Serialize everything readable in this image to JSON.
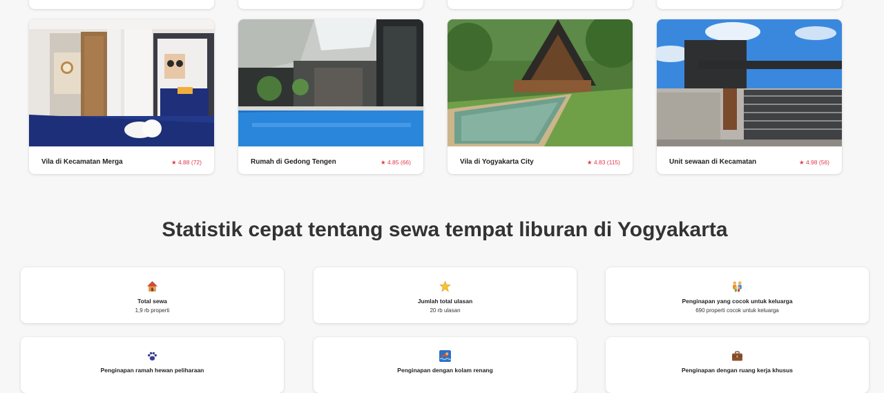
{
  "listings": [
    {
      "title": "Vila di Kecamatan Merga",
      "rating": "★ 4.88 (72)",
      "photo_icon": "bedroom-photo"
    },
    {
      "title": "Rumah di Gedong Tengen",
      "rating": "★ 4.85 (66)",
      "photo_icon": "indoor-pool-photo"
    },
    {
      "title": "Vila di Yogyakarta City",
      "rating": "★ 4.83 (115)",
      "photo_icon": "a-frame-villa-photo"
    },
    {
      "title": "Unit sewaan di Kecamatan",
      "rating": "★ 4.98 (56)",
      "photo_icon": "modern-house-photo"
    }
  ],
  "stats_section": {
    "title": "Statistik cepat tentang sewa tempat liburan di Yogyakarta"
  },
  "stats": [
    {
      "label": "Total sewa",
      "value": "1,9 rb properti",
      "icon": "house-icon"
    },
    {
      "label": "Jumlah total ulasan",
      "value": "20 rb ulasan",
      "icon": "star-icon"
    },
    {
      "label": "Penginapan yang cocok untuk keluarga",
      "value": "690 properti cocok untuk keluarga",
      "icon": "family-icon"
    },
    {
      "label": "Penginapan ramah hewan peliharaan",
      "value": "",
      "icon": "paw-icon"
    },
    {
      "label": "Penginapan dengan kolam renang",
      "value": "",
      "icon": "swimmer-icon"
    },
    {
      "label": "Penginapan dengan ruang kerja khusus",
      "value": "",
      "icon": "briefcase-icon"
    }
  ],
  "colors": {
    "rating": "#e0364f",
    "background": "#f7f7f7"
  }
}
